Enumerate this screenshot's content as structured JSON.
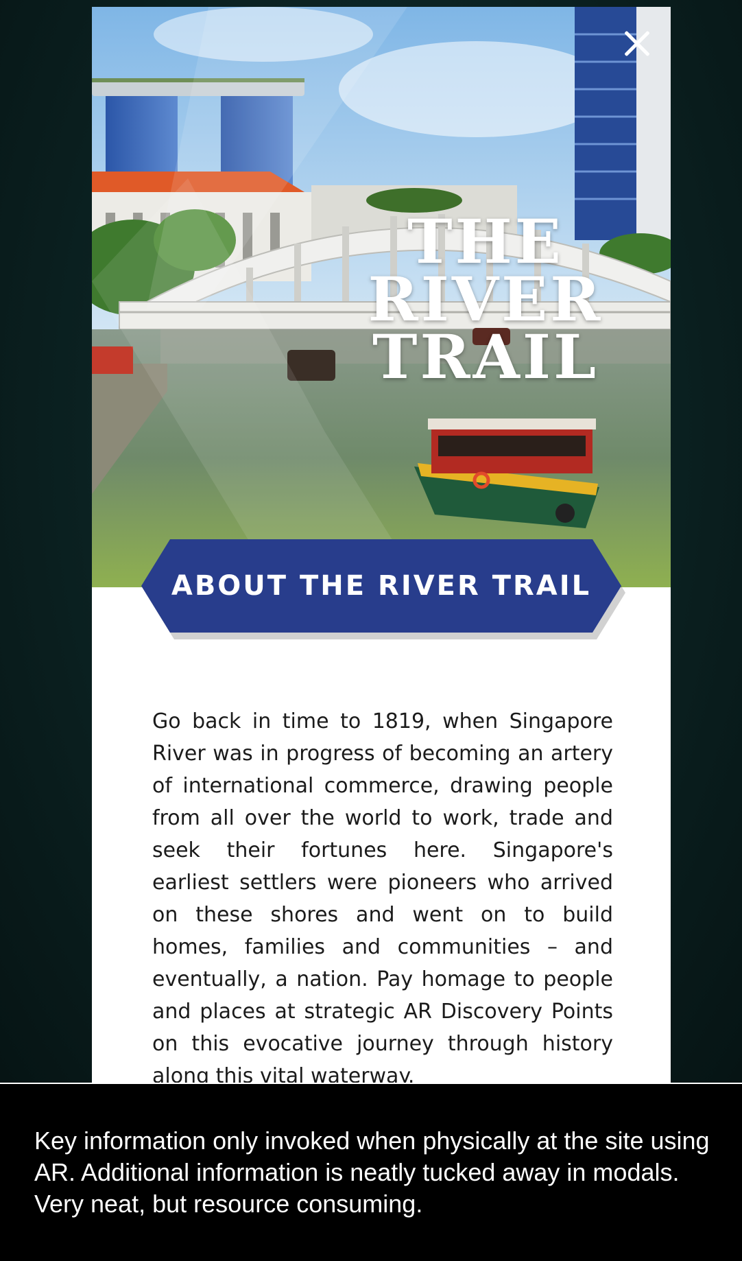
{
  "modal": {
    "title_lines": [
      "THE",
      "RIVER",
      "TRAIL"
    ],
    "close_icon": "close-icon",
    "section_heading": "ABOUT THE RIVER TRAIL",
    "description": "Go back in time to 1819, when Singapore River was in progress of becoming an artery of international commerce, drawing people from all over the world to work, trade and seek their fortunes here. Singapore's earliest settlers were pioneers who arrived on these shores and went on to build homes, families and communities – and eventually, a nation. Pay homage to people and places at strategic AR Discovery Points on this evocative journey through history along this vital waterway."
  },
  "caption": {
    "text": "Key information only invoked when physically at the site using AR. Additional information is neatly tucked away in modals. Very neat, but resource consuming."
  },
  "colors": {
    "banner": "#283d8c",
    "backdrop": "#0c2424",
    "modal_bg": "#ffffff",
    "caption_bg": "#000000"
  }
}
